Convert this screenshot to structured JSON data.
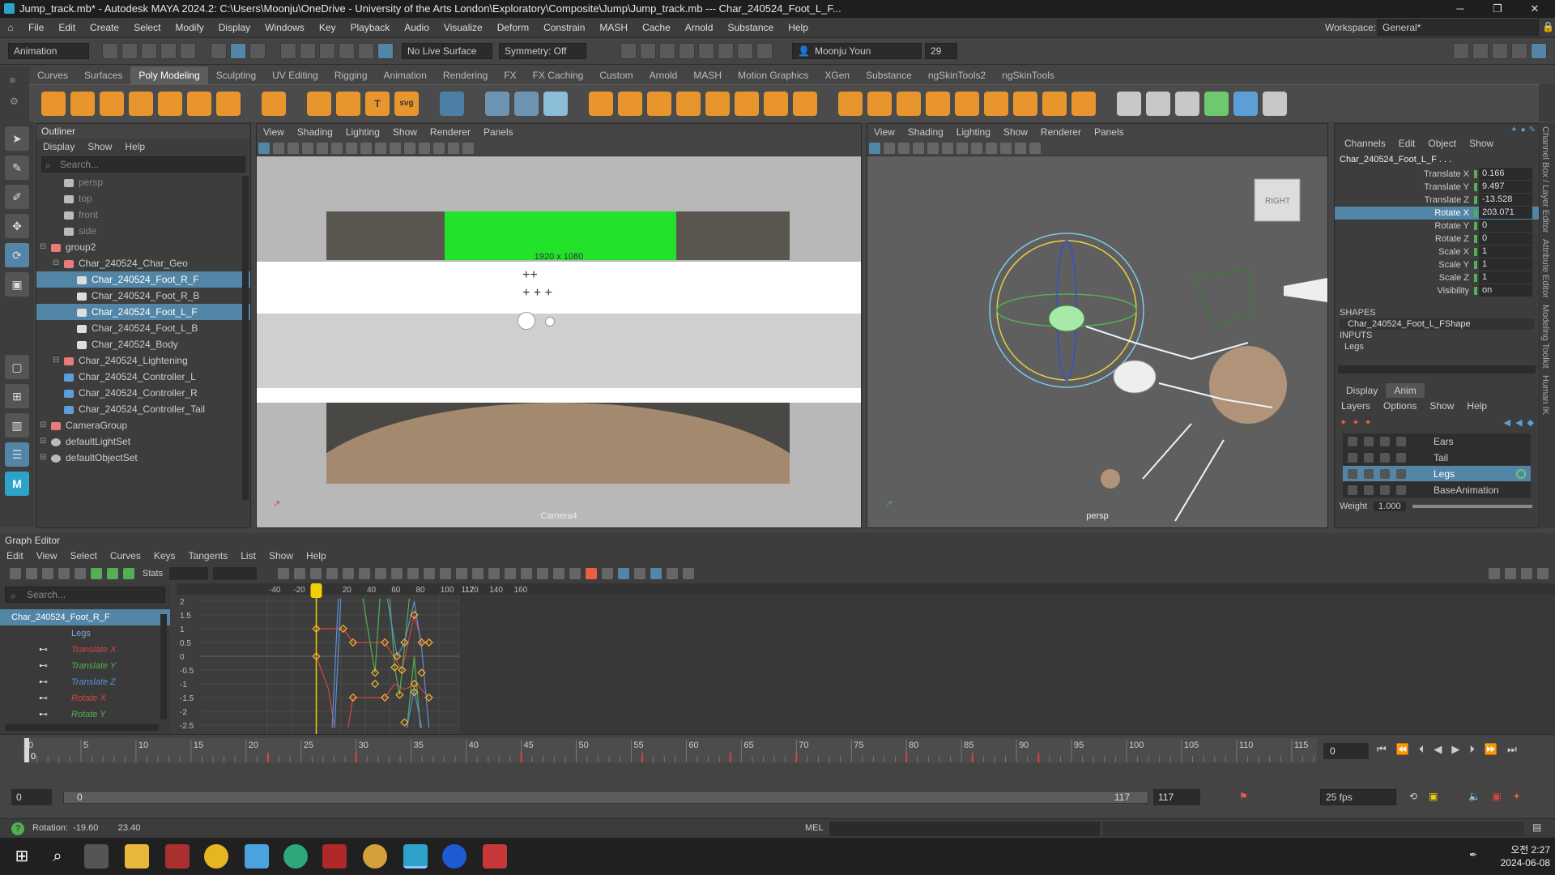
{
  "window": {
    "title": "Jump_track.mb* - Autodesk MAYA 2024.2: C:\\Users\\Moonju\\OneDrive - University of the Arts London\\Exploratory\\Composite\\Jump\\Jump_track.mb  ---   Char_240524_Foot_L_F..."
  },
  "menus": [
    "File",
    "Edit",
    "Create",
    "Select",
    "Modify",
    "Display",
    "Windows",
    "Key",
    "Playback",
    "Audio",
    "Visualize",
    "Deform",
    "Constrain",
    "MASH",
    "Cache",
    "Arnold",
    "Substance",
    "Help"
  ],
  "workspace": {
    "label": "Workspace:",
    "value": "General*"
  },
  "statusline": {
    "mode": "Animation",
    "live_surface": "No Live Surface",
    "symmetry": "Symmetry: Off",
    "user": "Moonju Youn",
    "notifications": "29"
  },
  "shelf_tabs": [
    "Curves",
    "Surfaces",
    "Poly Modeling",
    "Sculpting",
    "UV Editing",
    "Rigging",
    "Animation",
    "Rendering",
    "FX",
    "FX Caching",
    "Custom",
    "Arnold",
    "MASH",
    "Motion Graphics",
    "XGen",
    "Substance",
    "ngSkinTools2",
    "ngSkinTools"
  ],
  "active_shelf_tab": "Poly Modeling",
  "outliner": {
    "title": "Outliner",
    "menu": [
      "Display",
      "Show",
      "Help"
    ],
    "search_placeholder": "Search...",
    "items": [
      {
        "label": "persp",
        "depth": 1,
        "type": "camera",
        "dim": true
      },
      {
        "label": "top",
        "depth": 1,
        "type": "camera",
        "dim": true
      },
      {
        "label": "front",
        "depth": 1,
        "type": "camera",
        "dim": true
      },
      {
        "label": "side",
        "depth": 1,
        "type": "camera",
        "dim": true
      },
      {
        "label": "group2",
        "depth": 0,
        "type": "group"
      },
      {
        "label": "Char_240524_Char_Geo",
        "depth": 1,
        "type": "group"
      },
      {
        "label": "Char_240524_Foot_R_F",
        "depth": 2,
        "type": "mesh",
        "selected": true
      },
      {
        "label": "Char_240524_Foot_R_B",
        "depth": 2,
        "type": "mesh"
      },
      {
        "label": "Char_240524_Foot_L_F",
        "depth": 2,
        "type": "mesh",
        "selected": true
      },
      {
        "label": "Char_240524_Foot_L_B",
        "depth": 2,
        "type": "mesh"
      },
      {
        "label": "Char_240524_Body",
        "depth": 2,
        "type": "mesh"
      },
      {
        "label": "Char_240524_Lightening",
        "depth": 1,
        "type": "group"
      },
      {
        "label": "Char_240524_Controller_L",
        "depth": 1,
        "type": "curve"
      },
      {
        "label": "Char_240524_Controller_R",
        "depth": 1,
        "type": "curve"
      },
      {
        "label": "Char_240524_Controller_Tail",
        "depth": 1,
        "type": "curve"
      },
      {
        "label": "CameraGroup",
        "depth": 0,
        "type": "group"
      },
      {
        "label": "defaultLightSet",
        "depth": 0,
        "type": "set"
      },
      {
        "label": "defaultObjectSet",
        "depth": 0,
        "type": "set"
      }
    ]
  },
  "viewport_menu": [
    "View",
    "Shading",
    "Lighting",
    "Show",
    "Renderer",
    "Panels"
  ],
  "viewport_left": {
    "resolution": "1920 x 1080",
    "camera": "Camera4"
  },
  "viewport_right": {
    "camera": "persp",
    "viewcube": "RIGHT"
  },
  "channelbox": {
    "tabs": [
      "Channels",
      "Edit",
      "Object",
      "Show"
    ],
    "object": "Char_240524_Foot_L_F . . .",
    "channels": [
      {
        "name": "Translate X",
        "value": "0.166"
      },
      {
        "name": "Translate Y",
        "value": "9.497"
      },
      {
        "name": "Translate Z",
        "value": "-13.528"
      },
      {
        "name": "Rotate X",
        "value": "203.071",
        "highlight": true
      },
      {
        "name": "Rotate Y",
        "value": "0"
      },
      {
        "name": "Rotate Z",
        "value": "0"
      },
      {
        "name": "Scale X",
        "value": "1"
      },
      {
        "name": "Scale Y",
        "value": "1"
      },
      {
        "name": "Scale Z",
        "value": "1"
      },
      {
        "name": "Visibility",
        "value": "on"
      }
    ],
    "shapes_label": "SHAPES",
    "shape": "Char_240524_Foot_L_FShape",
    "inputs_label": "INPUTS",
    "input": "Legs",
    "layer_tabs": [
      "Display",
      "Anim"
    ],
    "layer_menu": [
      "Layers",
      "Options",
      "Show",
      "Help"
    ],
    "layers": [
      {
        "name": "Ears"
      },
      {
        "name": "Tail"
      },
      {
        "name": "Legs",
        "selected": true
      },
      {
        "name": "BaseAnimation"
      }
    ],
    "weight_label": "Weight",
    "weight_value": "1.000"
  },
  "side_tabs": [
    "Channel Box / Layer Editor",
    "Attribute Editor",
    "Modeling Toolkit",
    "Human IK"
  ],
  "graph_editor": {
    "title": "Graph Editor",
    "menu": [
      "Edit",
      "View",
      "Select",
      "Curves",
      "Keys",
      "Tangents",
      "List",
      "Show",
      "Help"
    ],
    "stats_label": "Stats",
    "search_placeholder": "Search...",
    "tree": [
      {
        "label": "Char_240524_Foot_R_F",
        "color": "#ffffff",
        "selected": true
      },
      {
        "label": "Legs",
        "color": "#7ea7d8"
      },
      {
        "label": "Translate X",
        "color": "#d64545"
      },
      {
        "label": "Translate Y",
        "color": "#52b052"
      },
      {
        "label": "Translate Z",
        "color": "#5c8fd6"
      },
      {
        "label": "Rotate X",
        "color": "#d64545"
      },
      {
        "label": "Rotate Y",
        "color": "#52b052"
      }
    ],
    "frame_labels": [
      "-40",
      "-20",
      "20",
      "40",
      "60",
      "80",
      "100",
      "117",
      "120",
      "140",
      "160"
    ],
    "value_labels": [
      "2",
      "1.5",
      "1",
      "0.5",
      "0",
      "-0.5",
      "-1",
      "-1.5",
      "-2",
      "-2.5"
    ],
    "current_frame": "0"
  },
  "timeline": {
    "ticks": [
      "0",
      "5",
      "10",
      "15",
      "20",
      "25",
      "30",
      "35",
      "40",
      "45",
      "50",
      "55",
      "60",
      "65",
      "70",
      "75",
      "80",
      "85",
      "90",
      "95",
      "100",
      "105",
      "110",
      "115"
    ],
    "current_frame": "0"
  },
  "range": {
    "start": "0",
    "inner_start": "0",
    "inner_end": "117",
    "end": "117",
    "fps": "25 fps"
  },
  "status": {
    "help_text": "Rotation:  -19.60        23.40",
    "mel_label": "MEL"
  },
  "taskbar": {
    "time": "오전 2:27",
    "date": "2024-06-08"
  },
  "colors": {
    "accent": "#5285a6",
    "current_time": "#f0d000",
    "curve_red": "#d64545",
    "curve_green": "#52b052",
    "curve_blue": "#5c8fd6",
    "key": "#f0b030"
  }
}
